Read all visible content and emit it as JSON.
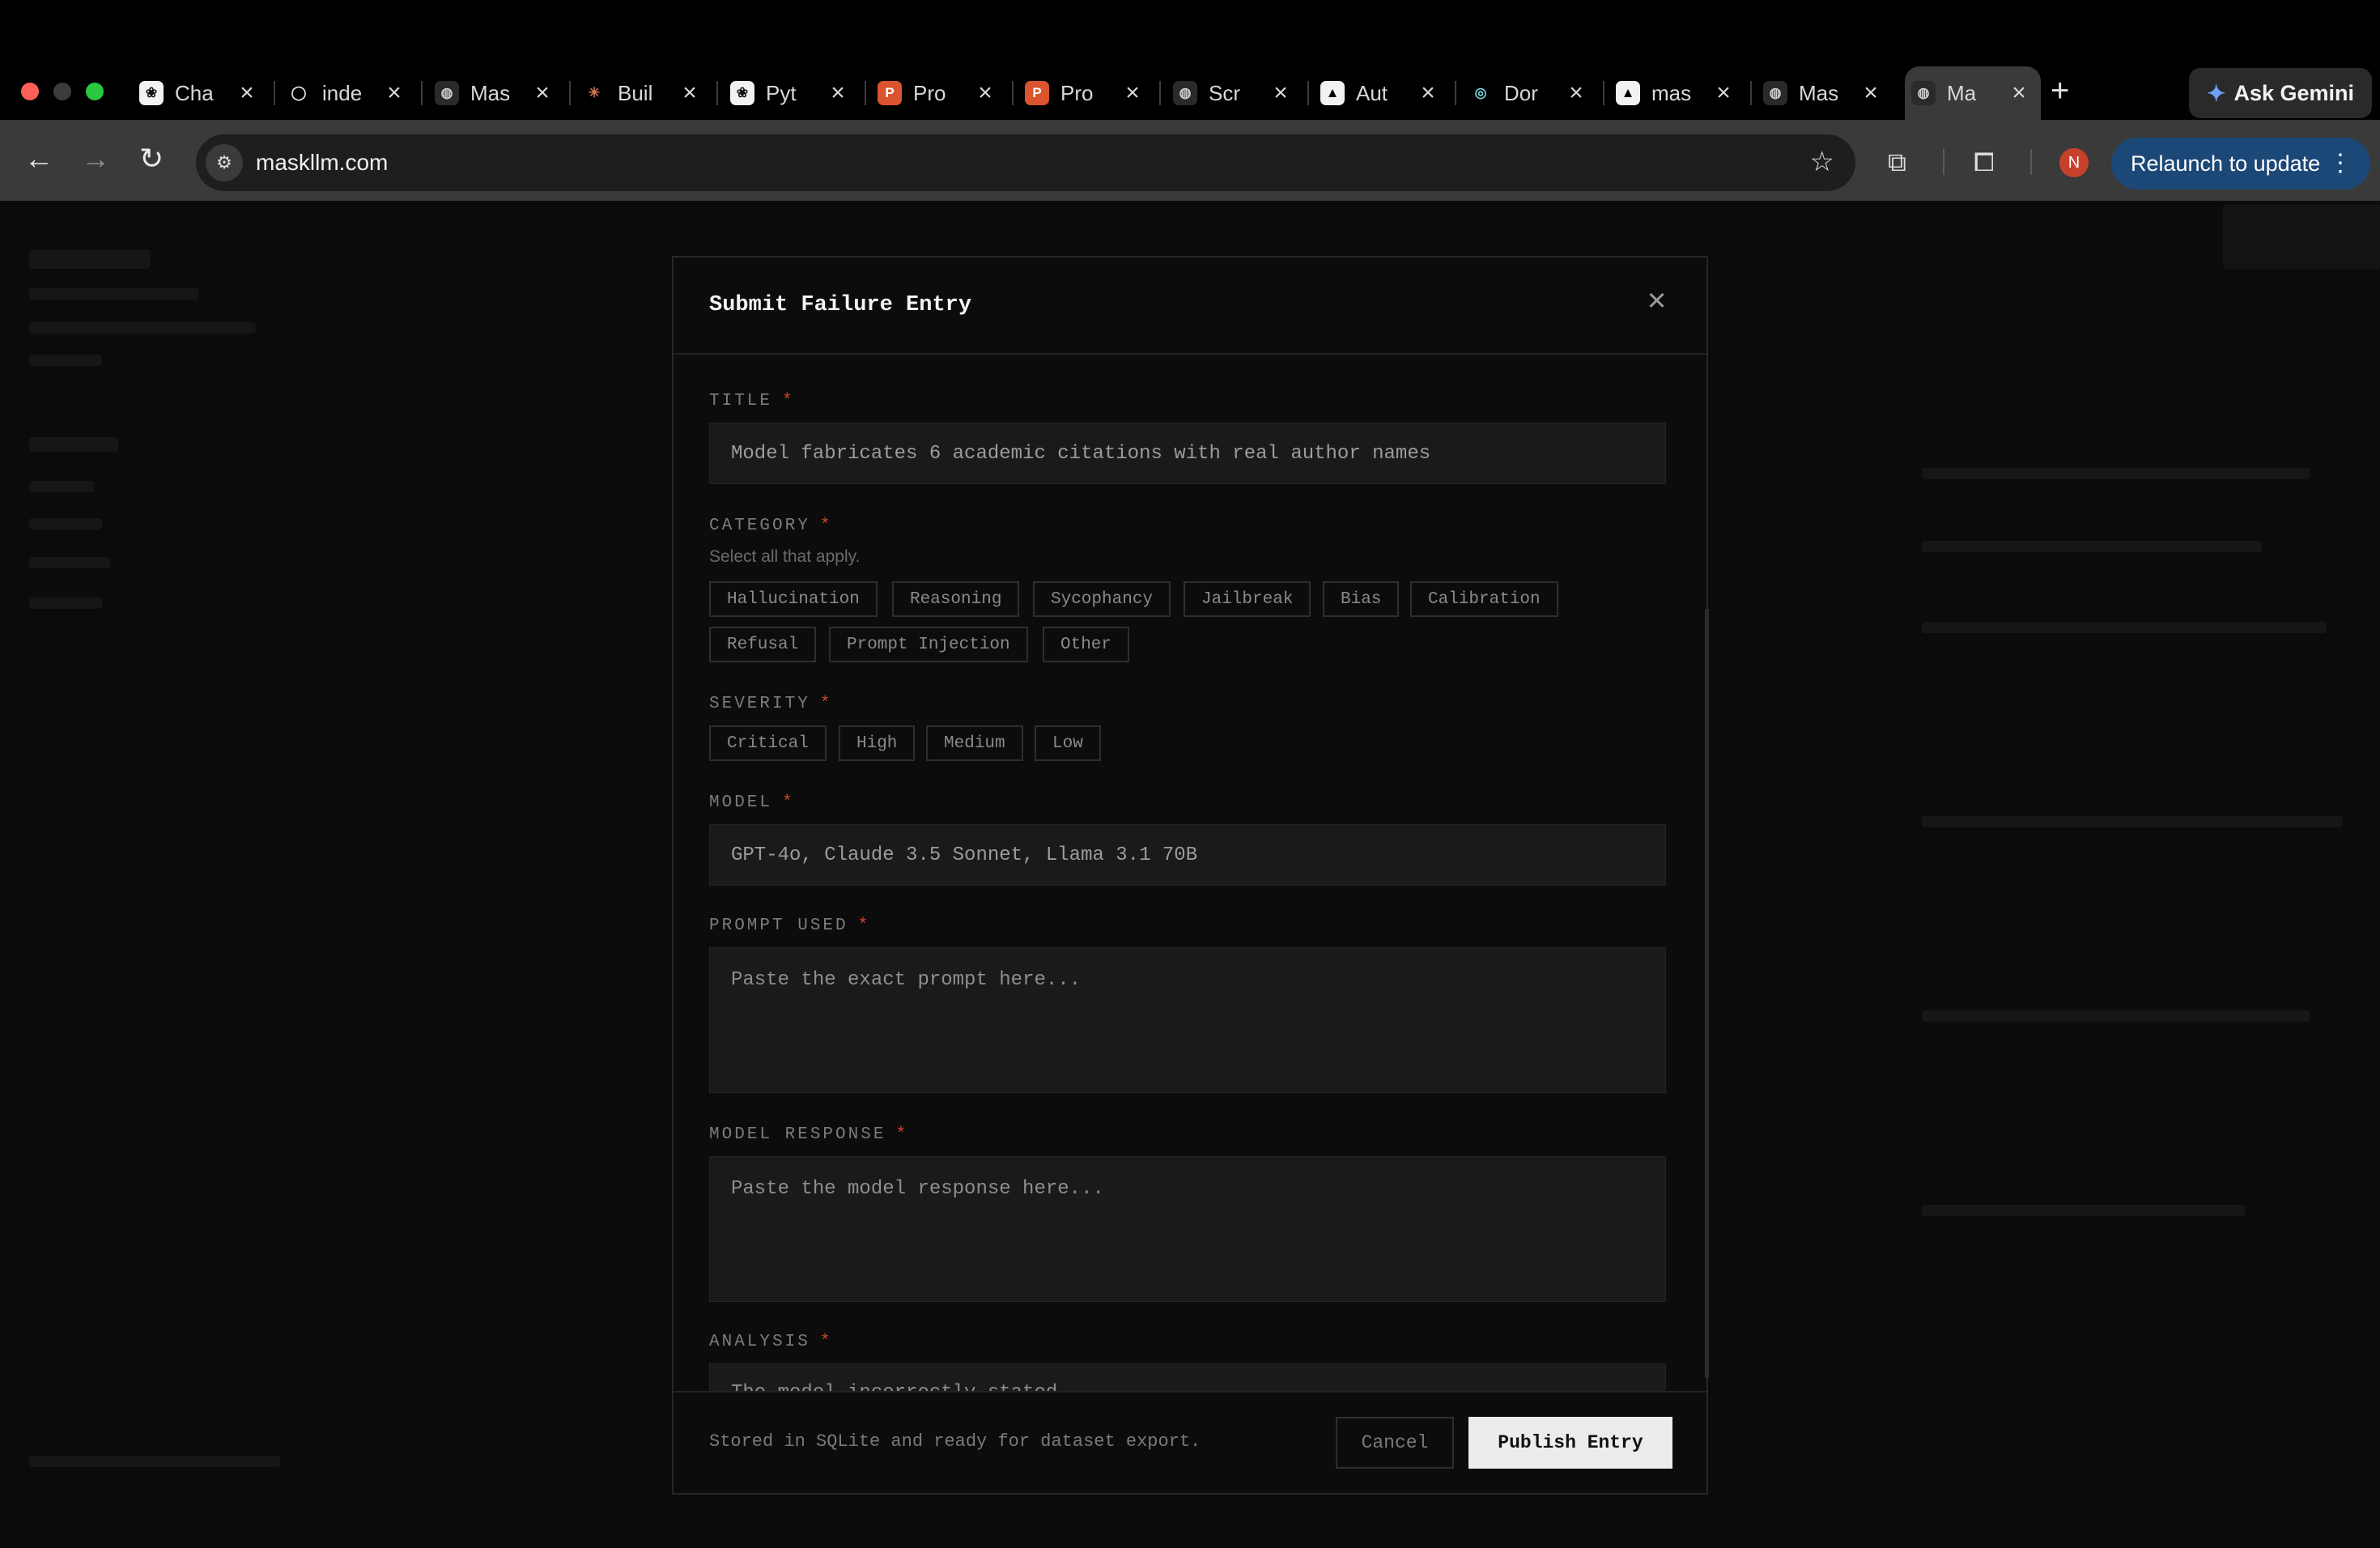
{
  "browser": {
    "tabs": [
      {
        "label": "Cha",
        "icon": "openai-icon"
      },
      {
        "label": "inde",
        "icon": "github-icon"
      },
      {
        "label": "Mas",
        "icon": "globe-icon"
      },
      {
        "label": "Buil",
        "icon": "claude-icon"
      },
      {
        "label": "Pyt",
        "icon": "openai-icon"
      },
      {
        "label": "Pro",
        "icon": "producthunt-icon"
      },
      {
        "label": "Pro",
        "icon": "producthunt-icon"
      },
      {
        "label": "Scr",
        "icon": "globe-icon"
      },
      {
        "label": "Aut",
        "icon": "triangle-icon"
      },
      {
        "label": "Dor",
        "icon": "spiral-icon"
      },
      {
        "label": "mas",
        "icon": "triangle-icon"
      },
      {
        "label": "Mas",
        "icon": "globe-icon"
      },
      {
        "label": "Ma",
        "icon": "globe-icon",
        "active": true
      }
    ],
    "gemini_label": "Ask Gemini",
    "url": "maskllm.com",
    "profile_initial": "N",
    "relaunch_label": "Relaunch to update"
  },
  "modal": {
    "title": "Submit Failure Entry",
    "fields": {
      "title": {
        "label": "TITLE",
        "value": "Model fabricates 6 academic citations with real author names"
      },
      "category": {
        "label": "CATEGORY",
        "hint": "Select all that apply.",
        "options": [
          "Hallucination",
          "Reasoning",
          "Sycophancy",
          "Jailbreak",
          "Bias",
          "Calibration",
          "Refusal",
          "Prompt Injection",
          "Other"
        ]
      },
      "severity": {
        "label": "SEVERITY",
        "options": [
          "Critical",
          "High",
          "Medium",
          "Low"
        ]
      },
      "model": {
        "label": "MODEL",
        "value": "GPT-4o, Claude 3.5 Sonnet, Llama 3.1 70B"
      },
      "prompt": {
        "label": "PROMPT USED",
        "placeholder": "Paste the exact prompt here..."
      },
      "response": {
        "label": "MODEL RESPONSE",
        "placeholder": "Paste the model response here..."
      },
      "analysis": {
        "label": "ANALYSIS",
        "placeholder": "The model incorrectly stated..."
      }
    },
    "required_mark": "*",
    "footer_note": "Stored in SQLite and ready for dataset export.",
    "cancel_label": "Cancel",
    "publish_label": "Publish Entry"
  },
  "colors": {
    "required": "#d0452f",
    "relaunch_bg": "#1c4878",
    "publish_bg": "#ececec"
  }
}
